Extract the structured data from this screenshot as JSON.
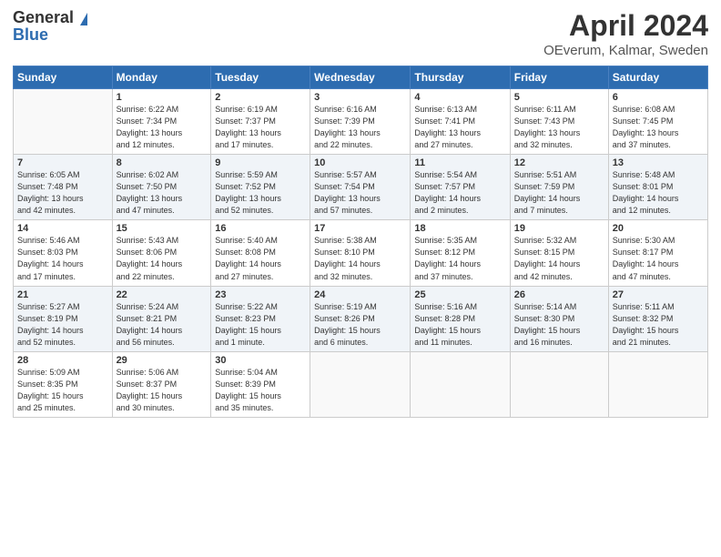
{
  "header": {
    "logo_general": "General",
    "logo_blue": "Blue",
    "title": "April 2024",
    "location": "OEverum, Kalmar, Sweden"
  },
  "weekdays": [
    "Sunday",
    "Monday",
    "Tuesday",
    "Wednesday",
    "Thursday",
    "Friday",
    "Saturday"
  ],
  "weeks": [
    [
      {
        "day": "",
        "info": ""
      },
      {
        "day": "1",
        "info": "Sunrise: 6:22 AM\nSunset: 7:34 PM\nDaylight: 13 hours\nand 12 minutes."
      },
      {
        "day": "2",
        "info": "Sunrise: 6:19 AM\nSunset: 7:37 PM\nDaylight: 13 hours\nand 17 minutes."
      },
      {
        "day": "3",
        "info": "Sunrise: 6:16 AM\nSunset: 7:39 PM\nDaylight: 13 hours\nand 22 minutes."
      },
      {
        "day": "4",
        "info": "Sunrise: 6:13 AM\nSunset: 7:41 PM\nDaylight: 13 hours\nand 27 minutes."
      },
      {
        "day": "5",
        "info": "Sunrise: 6:11 AM\nSunset: 7:43 PM\nDaylight: 13 hours\nand 32 minutes."
      },
      {
        "day": "6",
        "info": "Sunrise: 6:08 AM\nSunset: 7:45 PM\nDaylight: 13 hours\nand 37 minutes."
      }
    ],
    [
      {
        "day": "7",
        "info": "Sunrise: 6:05 AM\nSunset: 7:48 PM\nDaylight: 13 hours\nand 42 minutes."
      },
      {
        "day": "8",
        "info": "Sunrise: 6:02 AM\nSunset: 7:50 PM\nDaylight: 13 hours\nand 47 minutes."
      },
      {
        "day": "9",
        "info": "Sunrise: 5:59 AM\nSunset: 7:52 PM\nDaylight: 13 hours\nand 52 minutes."
      },
      {
        "day": "10",
        "info": "Sunrise: 5:57 AM\nSunset: 7:54 PM\nDaylight: 13 hours\nand 57 minutes."
      },
      {
        "day": "11",
        "info": "Sunrise: 5:54 AM\nSunset: 7:57 PM\nDaylight: 14 hours\nand 2 minutes."
      },
      {
        "day": "12",
        "info": "Sunrise: 5:51 AM\nSunset: 7:59 PM\nDaylight: 14 hours\nand 7 minutes."
      },
      {
        "day": "13",
        "info": "Sunrise: 5:48 AM\nSunset: 8:01 PM\nDaylight: 14 hours\nand 12 minutes."
      }
    ],
    [
      {
        "day": "14",
        "info": "Sunrise: 5:46 AM\nSunset: 8:03 PM\nDaylight: 14 hours\nand 17 minutes."
      },
      {
        "day": "15",
        "info": "Sunrise: 5:43 AM\nSunset: 8:06 PM\nDaylight: 14 hours\nand 22 minutes."
      },
      {
        "day": "16",
        "info": "Sunrise: 5:40 AM\nSunset: 8:08 PM\nDaylight: 14 hours\nand 27 minutes."
      },
      {
        "day": "17",
        "info": "Sunrise: 5:38 AM\nSunset: 8:10 PM\nDaylight: 14 hours\nand 32 minutes."
      },
      {
        "day": "18",
        "info": "Sunrise: 5:35 AM\nSunset: 8:12 PM\nDaylight: 14 hours\nand 37 minutes."
      },
      {
        "day": "19",
        "info": "Sunrise: 5:32 AM\nSunset: 8:15 PM\nDaylight: 14 hours\nand 42 minutes."
      },
      {
        "day": "20",
        "info": "Sunrise: 5:30 AM\nSunset: 8:17 PM\nDaylight: 14 hours\nand 47 minutes."
      }
    ],
    [
      {
        "day": "21",
        "info": "Sunrise: 5:27 AM\nSunset: 8:19 PM\nDaylight: 14 hours\nand 52 minutes."
      },
      {
        "day": "22",
        "info": "Sunrise: 5:24 AM\nSunset: 8:21 PM\nDaylight: 14 hours\nand 56 minutes."
      },
      {
        "day": "23",
        "info": "Sunrise: 5:22 AM\nSunset: 8:23 PM\nDaylight: 15 hours\nand 1 minute."
      },
      {
        "day": "24",
        "info": "Sunrise: 5:19 AM\nSunset: 8:26 PM\nDaylight: 15 hours\nand 6 minutes."
      },
      {
        "day": "25",
        "info": "Sunrise: 5:16 AM\nSunset: 8:28 PM\nDaylight: 15 hours\nand 11 minutes."
      },
      {
        "day": "26",
        "info": "Sunrise: 5:14 AM\nSunset: 8:30 PM\nDaylight: 15 hours\nand 16 minutes."
      },
      {
        "day": "27",
        "info": "Sunrise: 5:11 AM\nSunset: 8:32 PM\nDaylight: 15 hours\nand 21 minutes."
      }
    ],
    [
      {
        "day": "28",
        "info": "Sunrise: 5:09 AM\nSunset: 8:35 PM\nDaylight: 15 hours\nand 25 minutes."
      },
      {
        "day": "29",
        "info": "Sunrise: 5:06 AM\nSunset: 8:37 PM\nDaylight: 15 hours\nand 30 minutes."
      },
      {
        "day": "30",
        "info": "Sunrise: 5:04 AM\nSunset: 8:39 PM\nDaylight: 15 hours\nand 35 minutes."
      },
      {
        "day": "",
        "info": ""
      },
      {
        "day": "",
        "info": ""
      },
      {
        "day": "",
        "info": ""
      },
      {
        "day": "",
        "info": ""
      }
    ]
  ]
}
